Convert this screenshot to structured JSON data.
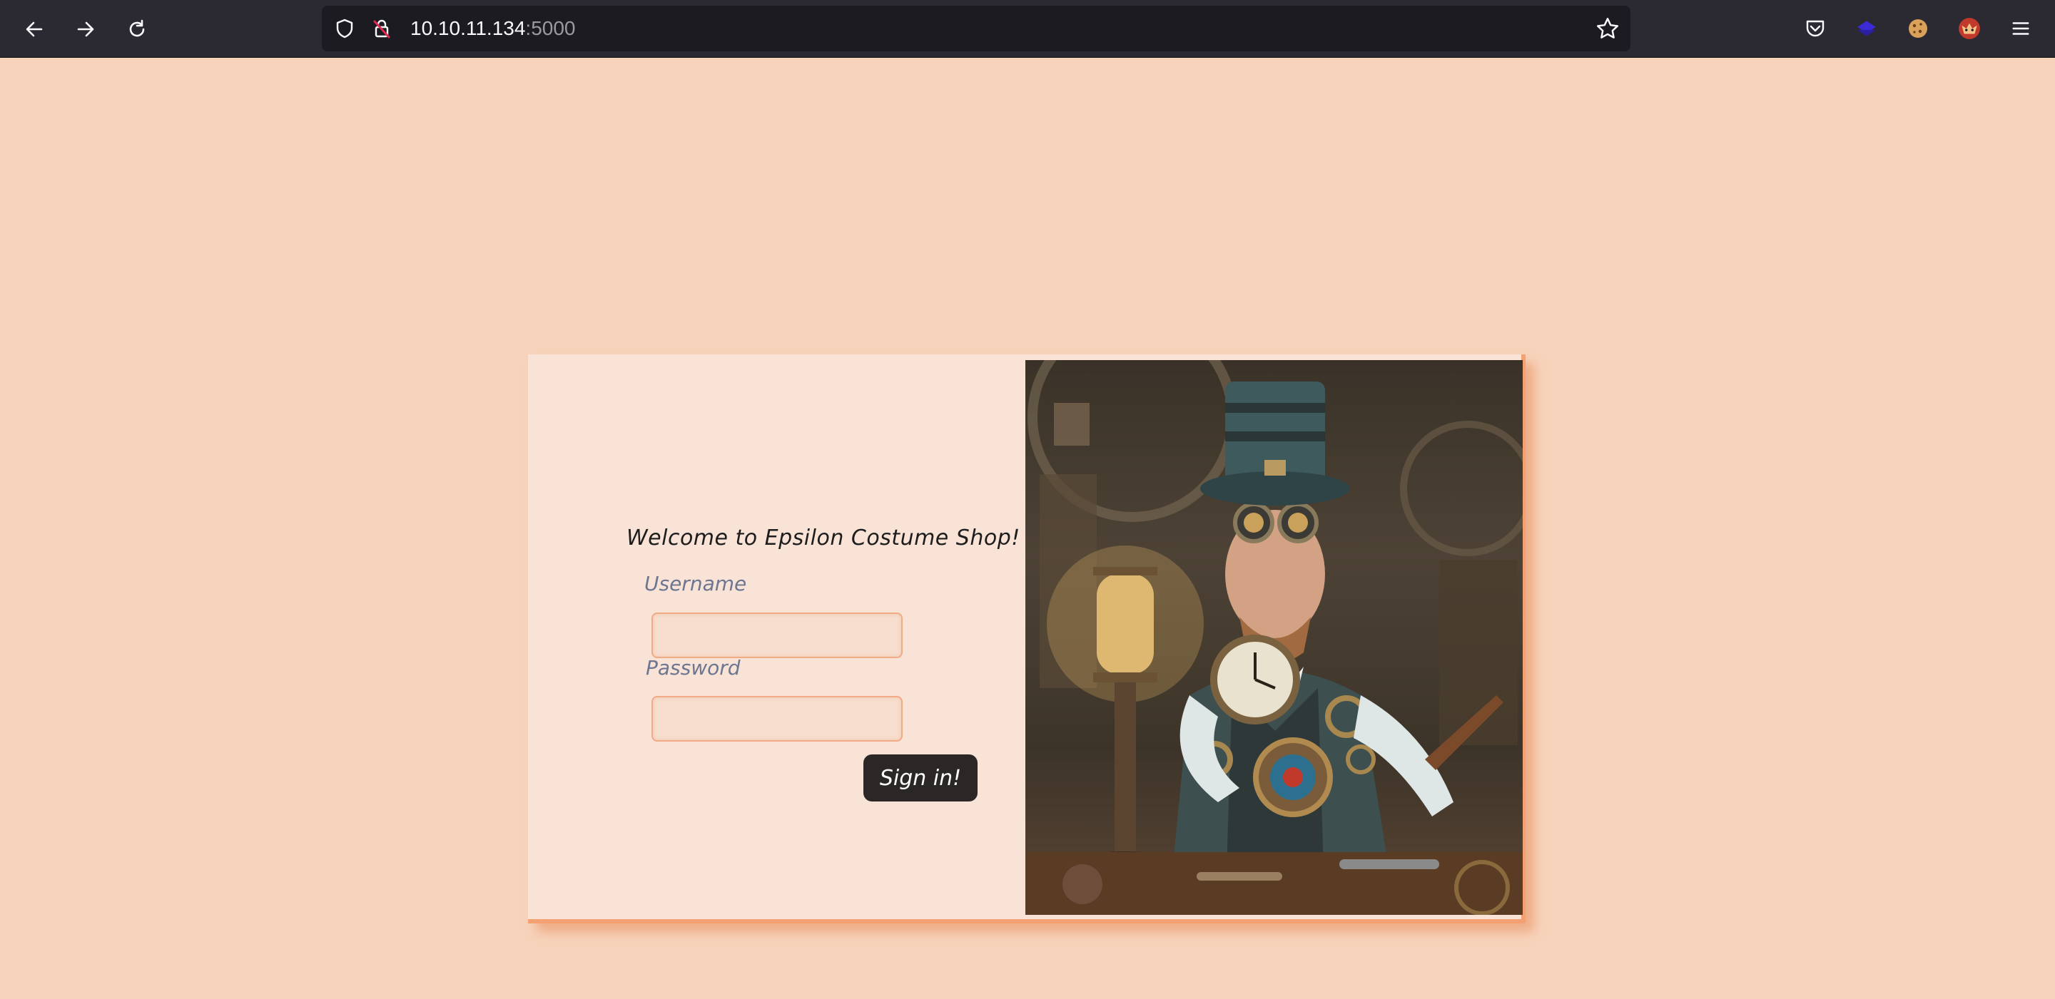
{
  "browser": {
    "url_host": "10.10.11.134",
    "url_port": ":5000",
    "icons": {
      "back": "arrow-left-icon",
      "forward": "arrow-right-icon",
      "reload": "reload-icon",
      "shield": "shield-icon",
      "insecure": "insecure-lock-icon",
      "bookmark": "star-icon",
      "pocket": "pocket-icon",
      "extension1": "extension-purple-icon",
      "extension2": "cookie-icon",
      "extension3": "fox-icon",
      "menu": "hamburger-menu-icon"
    }
  },
  "login": {
    "welcome": "Welcome to Epsilon Costume Shop!",
    "username_label": "Username",
    "username_value": "",
    "password_label": "Password",
    "password_value": "",
    "submit_label": "Sign in!"
  },
  "colors": {
    "page_bg": "#f7d3bb",
    "card_bg": "#f9e3d6",
    "accent": "#f3a073",
    "button_bg": "#2b2726"
  }
}
